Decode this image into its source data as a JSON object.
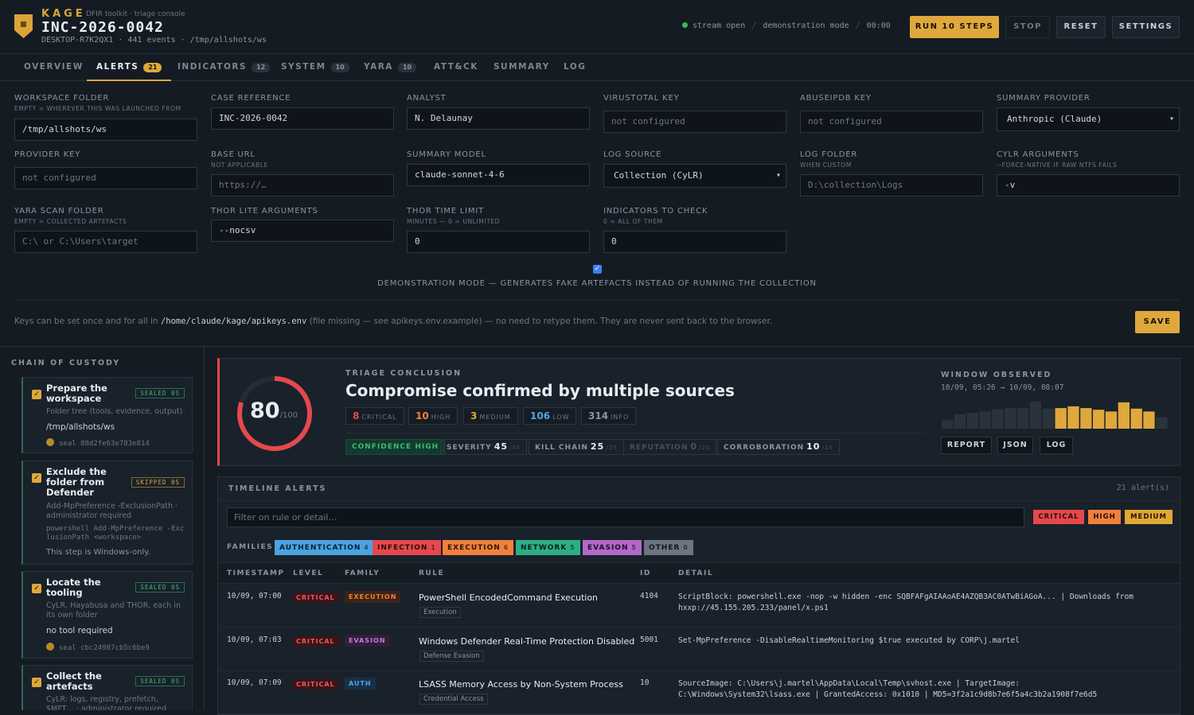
{
  "header": {
    "brand": "KAGE",
    "brand_sub": "DFIR toolkit · triage console",
    "case_id": "INC-2026-0042",
    "case_meta": "DESKTOP-R7K2QX1 · 441 events · /tmp/allshots/ws",
    "status": {
      "stream": "stream open",
      "mode": "demonstration mode",
      "timer": "00:00"
    },
    "buttons": {
      "run": "RUN 10 STEPS",
      "stop": "STOP",
      "reset": "RESET",
      "settings": "SETTINGS"
    }
  },
  "tabs": [
    {
      "label": "OVERVIEW",
      "count": ""
    },
    {
      "label": "ALERTS",
      "count": "21"
    },
    {
      "label": "INDICATORS",
      "count": "12"
    },
    {
      "label": "SYSTEM",
      "count": "10"
    },
    {
      "label": "YARA",
      "count": "10"
    },
    {
      "label": "ATT&CK",
      "count": ""
    },
    {
      "label": "SUMMARY",
      "count": ""
    },
    {
      "label": "LOG",
      "count": ""
    }
  ],
  "config": {
    "workspace": {
      "label": "WORKSPACE FOLDER",
      "sub": "EMPTY = WHEREVER THIS WAS LAUNCHED FROM",
      "value": "/tmp/allshots/ws"
    },
    "case_ref": {
      "label": "CASE REFERENCE",
      "value": "INC-2026-0042"
    },
    "analyst": {
      "label": "ANALYST",
      "value": "N. Delaunay"
    },
    "virustotal": {
      "label": "VIRUSTOTAL KEY",
      "placeholder": "not configured"
    },
    "abuseipdb": {
      "label": "ABUSEIPDB KEY",
      "placeholder": "not configured"
    },
    "summary_provider": {
      "label": "SUMMARY PROVIDER",
      "value": "Anthropic (Claude)"
    },
    "provider_key": {
      "label": "PROVIDER KEY",
      "placeholder": "not configured"
    },
    "base_url": {
      "label": "BASE URL",
      "sub": "NOT APPLICABLE",
      "placeholder": "https://…"
    },
    "summary_model": {
      "label": "SUMMARY MODEL",
      "value": "claude-sonnet-4-6"
    },
    "log_source": {
      "label": "LOG SOURCE",
      "value": "Collection (CyLR)"
    },
    "log_folder": {
      "label": "LOG FOLDER",
      "sub": "WHEN CUSTOM",
      "placeholder": "D:\\collection\\Logs"
    },
    "cylr_args": {
      "label": "CYLR ARGUMENTS",
      "sub": "--FORCE-NATIVE IF RAW NTFS FAILS",
      "value": "-v"
    },
    "yara_folder": {
      "label": "YARA SCAN FOLDER",
      "sub": "EMPTY = COLLECTED ARTEFACTS",
      "placeholder": "C:\\ or C:\\Users\\target"
    },
    "thor_args": {
      "label": "THOR LITE ARGUMENTS",
      "value": "--nocsv"
    },
    "thor_time": {
      "label": "THOR TIME LIMIT",
      "sub": "MINUTES — 0 = UNLIMITED",
      "value": "0"
    },
    "indicators": {
      "label": "INDICATORS TO CHECK",
      "sub": "0 = ALL OF THEM",
      "value": "0"
    },
    "demo_label": "DEMONSTRATION MODE — GENERATES FAKE ARTEFACTS INSTEAD OF RUNNING THE COLLECTION",
    "keys_note_pre": "Keys can be set once and for all in",
    "keys_path": "/home/claude/kage/apikeys.env",
    "keys_note_post": "(file missing — see apikeys.env.example) — no need to retype them. They are never sent back to the browser.",
    "save": "SAVE"
  },
  "custody": {
    "title": "CHAIN OF CUSTODY",
    "steps": [
      {
        "title": "Prepare the workspace",
        "badge": "SEALED 0S",
        "desc": "Folder tree (tools, evidence, output)",
        "value": "/tmp/allshots/ws",
        "seal": "seal 88d2fe63e783e814"
      },
      {
        "title": "Exclude the folder from Defender",
        "badge": "SKIPPED 0S",
        "desc": "Add-MpPreference -ExclusionPath · administrator required",
        "cmd": "powershell Add-MpPreference -ExclusionPath <workspace>",
        "value": "This step is Windows-only."
      },
      {
        "title": "Locate the tooling",
        "badge": "SEALED 0S",
        "desc": "CyLR, Hayabusa and THOR, each in its own folder",
        "value": "no tool required",
        "seal": "seal cbc24987cb5c6be9"
      },
      {
        "title": "Collect the artefacts",
        "badge": "SEALED 0S",
        "desc": "CyLR: logs, registry, prefetch, $MFT… · administrator required"
      }
    ]
  },
  "conclusion": {
    "score": "80",
    "score_max": "/100",
    "label": "TRIAGE CONCLUSION",
    "title": "Compromise confirmed by multiple sources",
    "counts": [
      {
        "n": "8",
        "k": "CRITICAL"
      },
      {
        "n": "10",
        "k": "HIGH"
      },
      {
        "n": "3",
        "k": "MEDIUM"
      },
      {
        "n": "106",
        "k": "LOW"
      },
      {
        "n": "314",
        "k": "INFO"
      }
    ],
    "confidence": "CONFIDENCE HIGH",
    "scores": [
      {
        "k": "SEVERITY",
        "v": "45",
        "d": "/45"
      },
      {
        "k": "KILL CHAIN",
        "v": "25",
        "d": "/25"
      },
      {
        "k": "REPUTATION",
        "v": "0",
        "d": "/20"
      },
      {
        "k": "CORROBORATION",
        "v": "10",
        "d": "/10"
      }
    ],
    "window_label": "WINDOW OBSERVED",
    "window_range": "10/09, 05:26 → 10/09, 08:07",
    "histogram": [
      0.3,
      0.5,
      0.55,
      0.6,
      0.68,
      0.72,
      0.72,
      0.95,
      0.7,
      0.72,
      0.78,
      0.72,
      0.66,
      0.6,
      0.92,
      0.7,
      0.6,
      0.4
    ],
    "buttons": {
      "report": "REPORT",
      "json": "JSON",
      "log": "LOG"
    }
  },
  "timeline": {
    "title": "TIMELINE ALERTS",
    "count": "21 alert(s)",
    "filter_placeholder": "Filter on rule or detail…",
    "levels": [
      "CRITICAL",
      "HIGH",
      "MEDIUM"
    ],
    "families_label": "FAMILIES",
    "families": [
      {
        "name": "AUTHENTICATION",
        "count": "4"
      },
      {
        "name": "INFECTION",
        "count": "1"
      },
      {
        "name": "EXECUTION",
        "count": "6"
      },
      {
        "name": "NETWORK",
        "count": "5"
      },
      {
        "name": "EVASION",
        "count": "5"
      },
      {
        "name": "OTHER",
        "count": "0"
      }
    ],
    "columns": [
      "TIMESTAMP",
      "LEVEL",
      "FAMILY",
      "RULE",
      "ID",
      "DETAIL"
    ],
    "rows": [
      {
        "ts": "10/09, 07:00",
        "level": "CRITICAL",
        "family": "EXECUTION",
        "rule": "PowerShell EncodedCommand Execution",
        "tag": "Execution",
        "id": "4104",
        "detail": "ScriptBlock: powershell.exe -nop -w hidden -enc SQBFAFgAIAAoAE4AZQB3AC0ATwBiAGoA... | Downloads from hxxp://45.155.205.233/panel/x.ps1"
      },
      {
        "ts": "10/09, 07:03",
        "level": "CRITICAL",
        "family": "EVASION",
        "rule": "Windows Defender Real-Time Protection Disabled",
        "tag": "Defense Evasion",
        "id": "5001",
        "detail": "Set-MpPreference -DisableRealtimeMonitoring $true executed by CORP\\j.martel"
      },
      {
        "ts": "10/09, 07:09",
        "level": "CRITICAL",
        "family": "AUTH",
        "rule": "LSASS Memory Access by Non-System Process",
        "tag": "Credential Access",
        "id": "10",
        "detail": "SourceImage: C:\\Users\\j.martel\\AppData\\Local\\Temp\\svhost.exe | TargetImage: C:\\Windows\\System32\\lsass.exe | GrantedAccess: 0x1010 | MD5=3f2a1c9d8b7e6f5a4c3b2a1908f7e6d5"
      }
    ]
  },
  "colors": {
    "accent": "#dfa83c",
    "critical": "#e5484d",
    "high": "#f0803c",
    "medium": "#e0a935",
    "low": "#4ea8de",
    "ok": "#3fb970"
  }
}
